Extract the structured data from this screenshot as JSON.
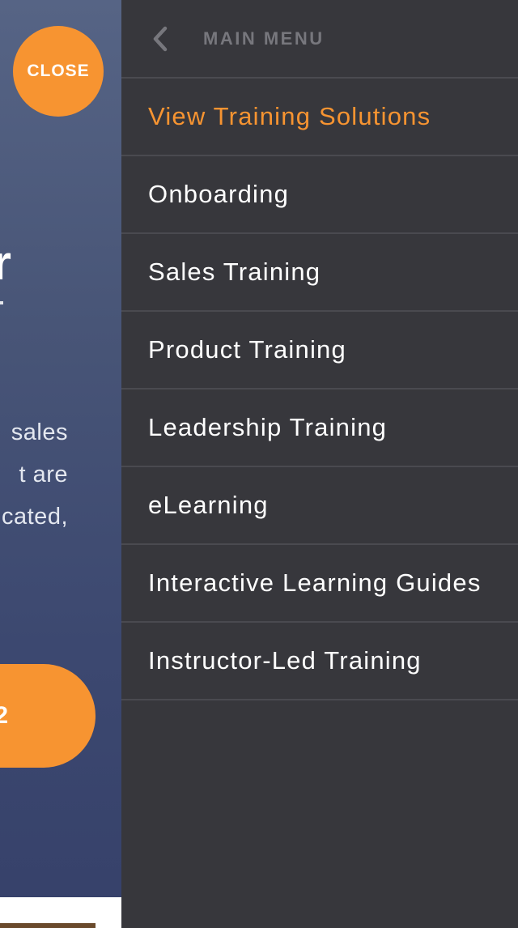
{
  "background_page": {
    "heading_fragment": "r",
    "paragraph_fragments": [
      "sales",
      "t are",
      "cated,"
    ],
    "cta_fragment": "2"
  },
  "close_button": {
    "label": "CLOSE"
  },
  "menu": {
    "header_title": "MAIN MENU",
    "back_icon": "chevron-left-icon",
    "items": [
      {
        "label": "View Training Solutions",
        "active": true
      },
      {
        "label": "Onboarding",
        "active": false
      },
      {
        "label": "Sales Training",
        "active": false
      },
      {
        "label": "Product Training",
        "active": false
      },
      {
        "label": "Leadership Training",
        "active": false
      },
      {
        "label": "eLearning",
        "active": false
      },
      {
        "label": "Interactive Learning Guides",
        "active": false
      },
      {
        "label": "Instructor-Led Training",
        "active": false
      }
    ]
  },
  "colors": {
    "accent": "#f79431",
    "drawer_bg": "#37373c",
    "divider": "#4a4a50",
    "header_text": "#77777d",
    "item_text": "#ffffff"
  }
}
